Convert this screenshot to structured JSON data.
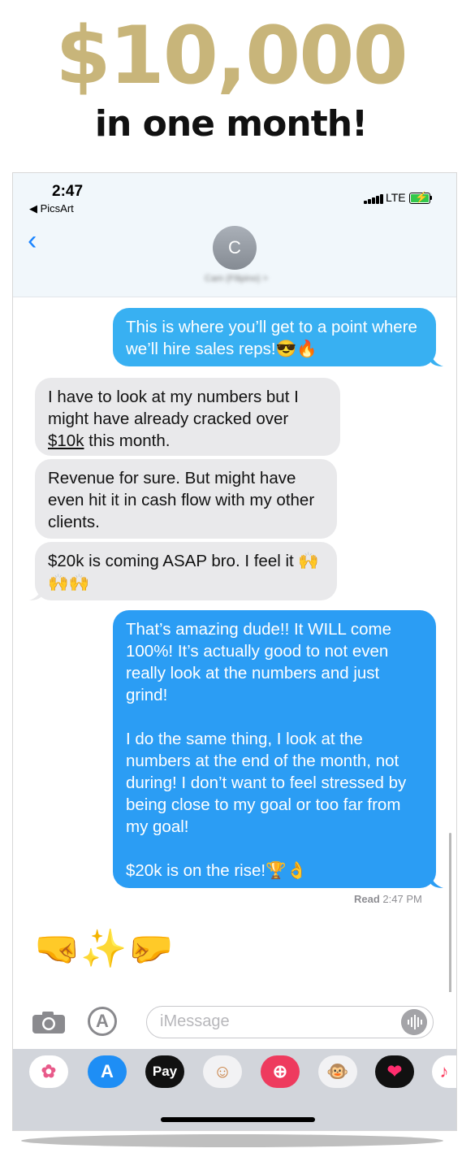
{
  "headline": "$10,000",
  "subhead": "in one month!",
  "status_bar": {
    "time": "2:47",
    "back_app": "◀ PicsArt",
    "network": "LTE"
  },
  "nav": {
    "back_icon": "chevron-left-icon",
    "avatar_initial": "C",
    "contact_name": "Cam (Filipino) >"
  },
  "messages": [
    {
      "side": "sent",
      "text": "This is where you’ll get to a point where we’ll hire sales reps!😎🔥"
    },
    {
      "side": "received",
      "text_before": "I have to look at my numbers but I might have already cracked over ",
      "text_underlined": "$10k",
      "text_after": " this month."
    },
    {
      "side": "received",
      "text": "Revenue for sure. But might have even hit it in cash flow with my other clients."
    },
    {
      "side": "received",
      "text": "$20k is coming ASAP bro. I feel it 🙌🙌🙌"
    },
    {
      "side": "sent",
      "paragraphs": [
        "That’s amazing dude!! It WILL come 100%! It’s actually good to not even really look at the numbers and just grind!",
        "I do the same thing, I look at the numbers at the end of the month, not during! I don’t want to feel stressed by being close to my goal or too far from my goal!",
        "$20k is on the rise!🏆👌"
      ]
    }
  ],
  "read_receipt": {
    "label": "Read",
    "time": "2:47 PM"
  },
  "reply_emoji": "🤜✨🤛",
  "composer": {
    "placeholder": "iMessage",
    "camera_icon": "camera-icon",
    "apps_icon": "app-store-icon",
    "mic_icon": "audio-waveform-icon"
  },
  "dock": [
    {
      "name": "photos-app-icon",
      "label": "✿",
      "color": "#ffffff"
    },
    {
      "name": "app-store-app-icon",
      "label": "A",
      "color": "#1e8ef5"
    },
    {
      "name": "apple-pay-app-icon",
      "label": "Pay",
      "color": "#111111"
    },
    {
      "name": "memoji-app-icon",
      "label": "☺",
      "color": "#f2f2f4"
    },
    {
      "name": "search-images-app-icon",
      "label": "⊕",
      "color": "#ee3b5e"
    },
    {
      "name": "animoji-app-icon",
      "label": "🐵",
      "color": "#f2f2f4"
    },
    {
      "name": "digital-touch-app-icon",
      "label": "❤",
      "color": "#111111"
    },
    {
      "name": "music-app-icon",
      "label": "♪",
      "color": "#ffffff"
    }
  ],
  "colors": {
    "headline": "#c8b57a",
    "sent_bubble": "#2b9df4",
    "received_bubble": "#e9e9eb",
    "accent": "#1a84ff"
  }
}
